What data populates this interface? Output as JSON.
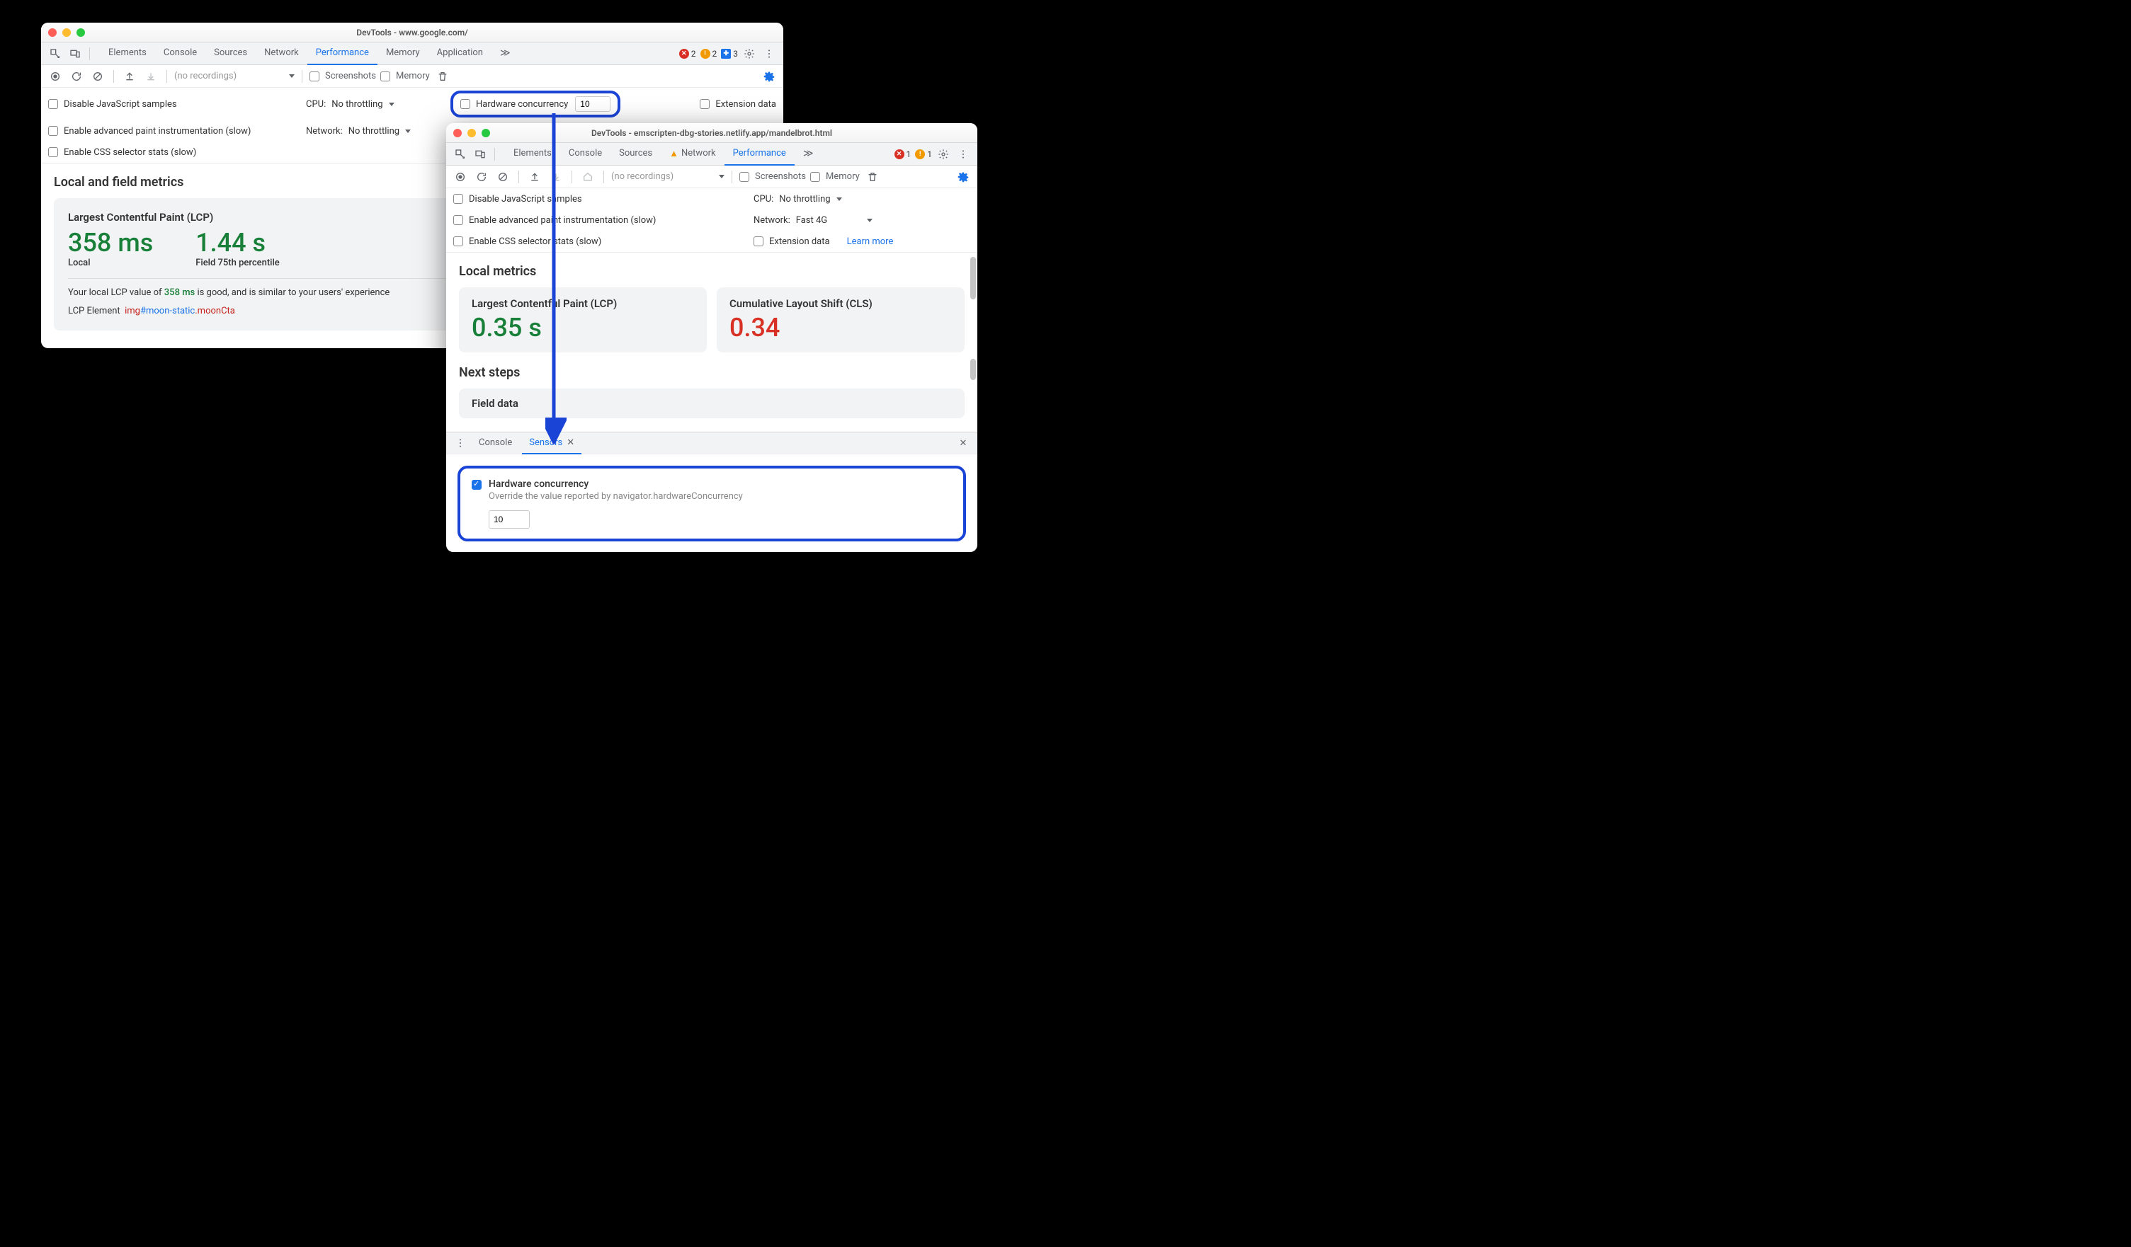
{
  "window1": {
    "title": "DevTools - www.google.com/",
    "tabs": [
      "Elements",
      "Console",
      "Sources",
      "Network",
      "Performance",
      "Memory",
      "Application"
    ],
    "active_tab": "Performance",
    "badges": {
      "errors": "2",
      "warnings": "2",
      "info": "3"
    },
    "recordings_placeholder": "(no recordings)",
    "cb_screenshots": "Screenshots",
    "cb_memory": "Memory",
    "opt_disable_js": "Disable JavaScript samples",
    "opt_paint": "Enable advanced paint instrumentation (slow)",
    "opt_css": "Enable CSS selector stats (slow)",
    "cpu_label": "CPU:",
    "cpu_value": "No throttling",
    "net_label": "Network:",
    "net_value": "No throttling",
    "hw_label": "Hardware concurrency",
    "hw_value": "10",
    "ext_label": "Extension data",
    "metrics_heading": "Local and field metrics",
    "lcp_title": "Largest Contentful Paint (LCP)",
    "lcp_local_value": "358 ms",
    "lcp_local_label": "Local",
    "lcp_field_value": "1.44 s",
    "lcp_field_label": "Field 75th percentile",
    "lcp_text_a": "Your local LCP value of ",
    "lcp_text_val": "358 ms",
    "lcp_text_b": " is good, and is similar to your users' experience",
    "lcp_el_label": "LCP Element",
    "lcp_el_tag": "img",
    "lcp_el_id": "#moon-static",
    "lcp_el_cls": ".moonCta"
  },
  "window2": {
    "title": "DevTools - emscripten-dbg-stories.netlify.app/mandelbrot.html",
    "tabs": [
      "Elements",
      "Console",
      "Sources",
      "Network",
      "Performance"
    ],
    "active_tab": "Performance",
    "network_warn": true,
    "badges": {
      "errors": "1",
      "warnings": "1"
    },
    "recordings_placeholder": "(no recordings)",
    "cb_screenshots": "Screenshots",
    "cb_memory": "Memory",
    "opt_disable_js": "Disable JavaScript samples",
    "opt_paint": "Enable advanced paint instrumentation (slow)",
    "opt_css": "Enable CSS selector stats (slow)",
    "cpu_label": "CPU:",
    "cpu_value": "No throttling",
    "net_label": "Network:",
    "net_value": "Fast 4G",
    "ext_label": "Extension data",
    "learn_more": "Learn more",
    "local_heading": "Local metrics",
    "lcp_title": "Largest Contentful Paint (LCP)",
    "lcp_value": "0.35 s",
    "cls_title": "Cumulative Layout Shift (CLS)",
    "cls_value": "0.34",
    "next_heading": "Next steps",
    "field_heading": "Field data",
    "drawer_tabs": [
      "Console",
      "Sensors"
    ],
    "drawer_active": "Sensors",
    "sensor_title": "Hardware concurrency",
    "sensor_desc": "Override the value reported by navigator.hardwareConcurrency",
    "sensor_value": "10"
  }
}
